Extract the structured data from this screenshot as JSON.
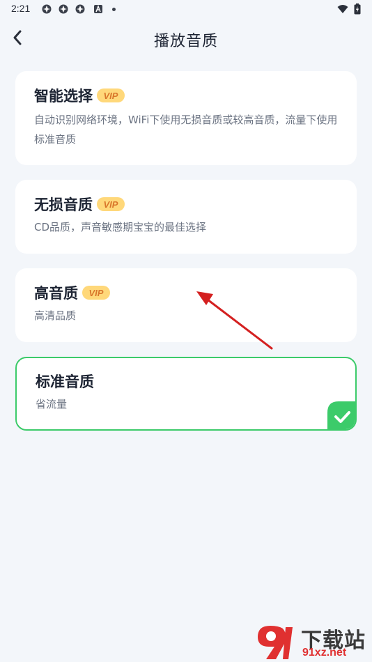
{
  "status_bar": {
    "time": "2:21"
  },
  "header": {
    "title": "播放音质"
  },
  "options": [
    {
      "title": "智能选择",
      "vip": true,
      "description": "自动识别网络环境，WiFi下使用无损音质或较高音质，流量下使用标准音质",
      "selected": false
    },
    {
      "title": "无损音质",
      "vip": true,
      "description": "CD品质，声音敏感期宝宝的最佳选择",
      "selected": false
    },
    {
      "title": "高音质",
      "vip": true,
      "description": "高清品质",
      "selected": false
    },
    {
      "title": "标准音质",
      "vip": false,
      "description": "省流量",
      "selected": true
    }
  ],
  "vip_label": "VIP",
  "watermark": {
    "top": "下载站",
    "bottom": "91xz.net"
  },
  "colors": {
    "background": "#f3f6fa",
    "selected_border": "#3ccb6a",
    "vip_badge": "#ffd87a",
    "vip_text": "#d9762b",
    "annotation_arrow": "#d42020"
  }
}
